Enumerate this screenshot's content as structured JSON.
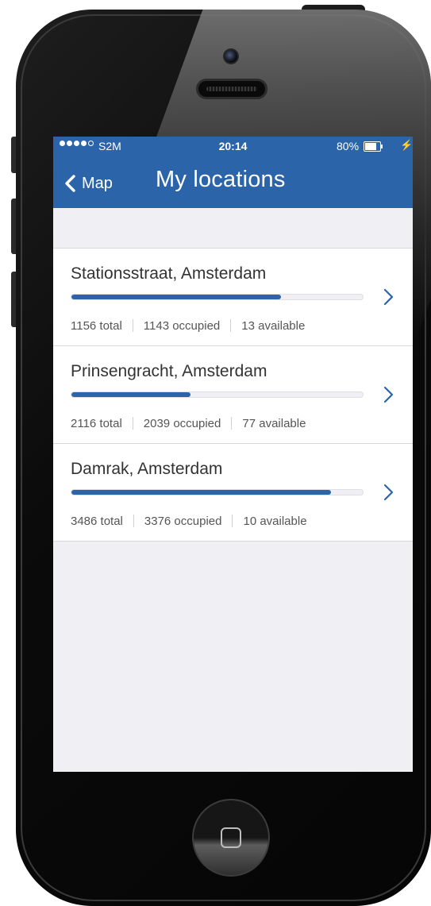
{
  "status_bar": {
    "carrier": "S2M",
    "time": "20:14",
    "battery": "80%",
    "battery_level": 0.8,
    "signal_bars_filled": 4,
    "signal_bars_total": 5
  },
  "nav": {
    "back_label": "Map",
    "title": "My locations"
  },
  "locations": [
    {
      "name": "Stationsstraat, Amsterdam",
      "total": "1156 total",
      "occupied": "1143 occupied",
      "available": "13 available",
      "fill_fraction": 0.72
    },
    {
      "name": "Prinsengracht, Amsterdam",
      "total": "2116 total",
      "occupied": "2039 occupied",
      "available": "77 available",
      "fill_fraction": 0.41
    },
    {
      "name": "Damrak, Amsterdam",
      "total": "3486 total",
      "occupied": "3376 occupied",
      "available": "10 available",
      "fill_fraction": 0.89
    }
  ],
  "colors": {
    "accent": "#2b64a8",
    "background": "#efeff4"
  },
  "icons": {
    "back": "chevron-left-icon",
    "row": "chevron-right-icon",
    "home": "home-button-icon"
  }
}
